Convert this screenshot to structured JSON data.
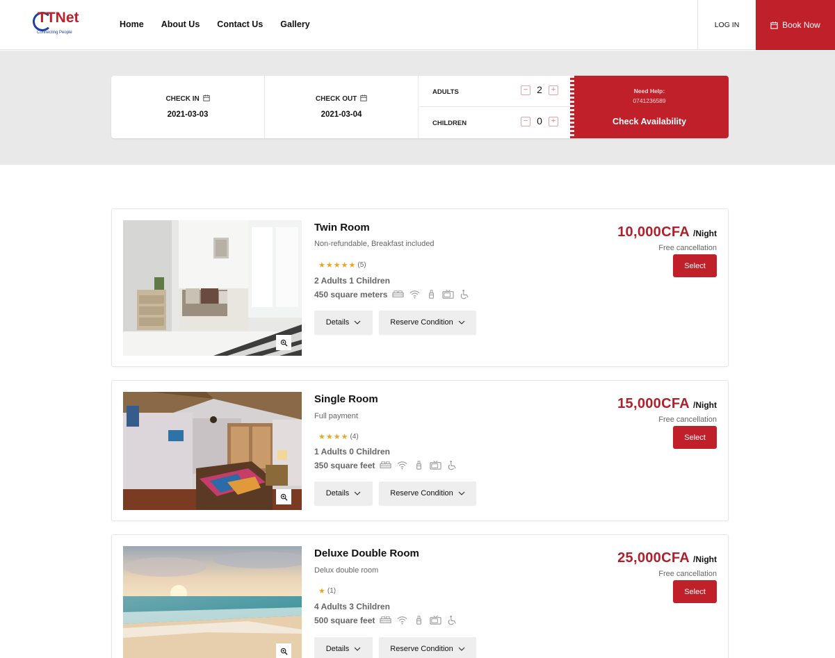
{
  "brand": {
    "name": "TTNet",
    "tagline": "Connecting People",
    "accent": "#c0202a",
    "secondary": "#1d3f9e"
  },
  "nav": {
    "items": [
      "Home",
      "About Us",
      "Contact Us",
      "Gallery"
    ]
  },
  "header": {
    "login_label": "LOG IN",
    "book_label": "Book Now",
    "book_icon": "calendar-icon"
  },
  "search": {
    "check_in_label": "CHECK IN",
    "check_in_value": "2021-03-03",
    "check_out_label": "CHECK OUT",
    "check_out_value": "2021-03-04",
    "adults_label": "ADULTS",
    "adults_value": "2",
    "children_label": "CHILDREN",
    "children_value": "0",
    "help_label": "Need Help:",
    "help_phone": "0741236589",
    "check_button": "Check Availability"
  },
  "rooms": [
    {
      "title": "Twin Room",
      "subtitle": "Non-refundable, Breakfast included",
      "stars": 5,
      "rating_count": "(5)",
      "occupancy": "2 Adults 1 Children",
      "size": "450 square meters",
      "price": "10,000CFA",
      "price_unit": "/Night",
      "cancellation": "Free cancellation",
      "select_label": "Select",
      "details_label": "Details",
      "reserve_label": "Reserve Condition",
      "amenities": [
        "bed-icon",
        "wifi-icon",
        "toiletries-icon",
        "tv-icon",
        "wheelchair-icon"
      ]
    },
    {
      "title": "Single Room",
      "subtitle": "Full payment",
      "stars": 4,
      "rating_count": "(4)",
      "occupancy": "1 Adults 0 Children",
      "size": "350 square feet",
      "price": "15,000CFA",
      "price_unit": "/Night",
      "cancellation": "Free cancellation",
      "select_label": "Select",
      "details_label": "Details",
      "reserve_label": "Reserve Condition",
      "amenities": [
        "bed-icon",
        "wifi-icon",
        "toiletries-icon",
        "tv-icon",
        "wheelchair-icon"
      ]
    },
    {
      "title": "Deluxe Double Room",
      "subtitle": "Delux double room",
      "stars": 1,
      "rating_count": "(1)",
      "occupancy": "4 Adults 3 Children",
      "size": "500 square feet",
      "price": "25,000CFA",
      "price_unit": "/Night",
      "cancellation": "Free cancellation",
      "select_label": "Select",
      "details_label": "Details",
      "reserve_label": "Reserve Condition",
      "amenities": [
        "bed-icon",
        "wifi-icon",
        "toiletries-icon",
        "tv-icon",
        "wheelchair-icon"
      ]
    }
  ]
}
